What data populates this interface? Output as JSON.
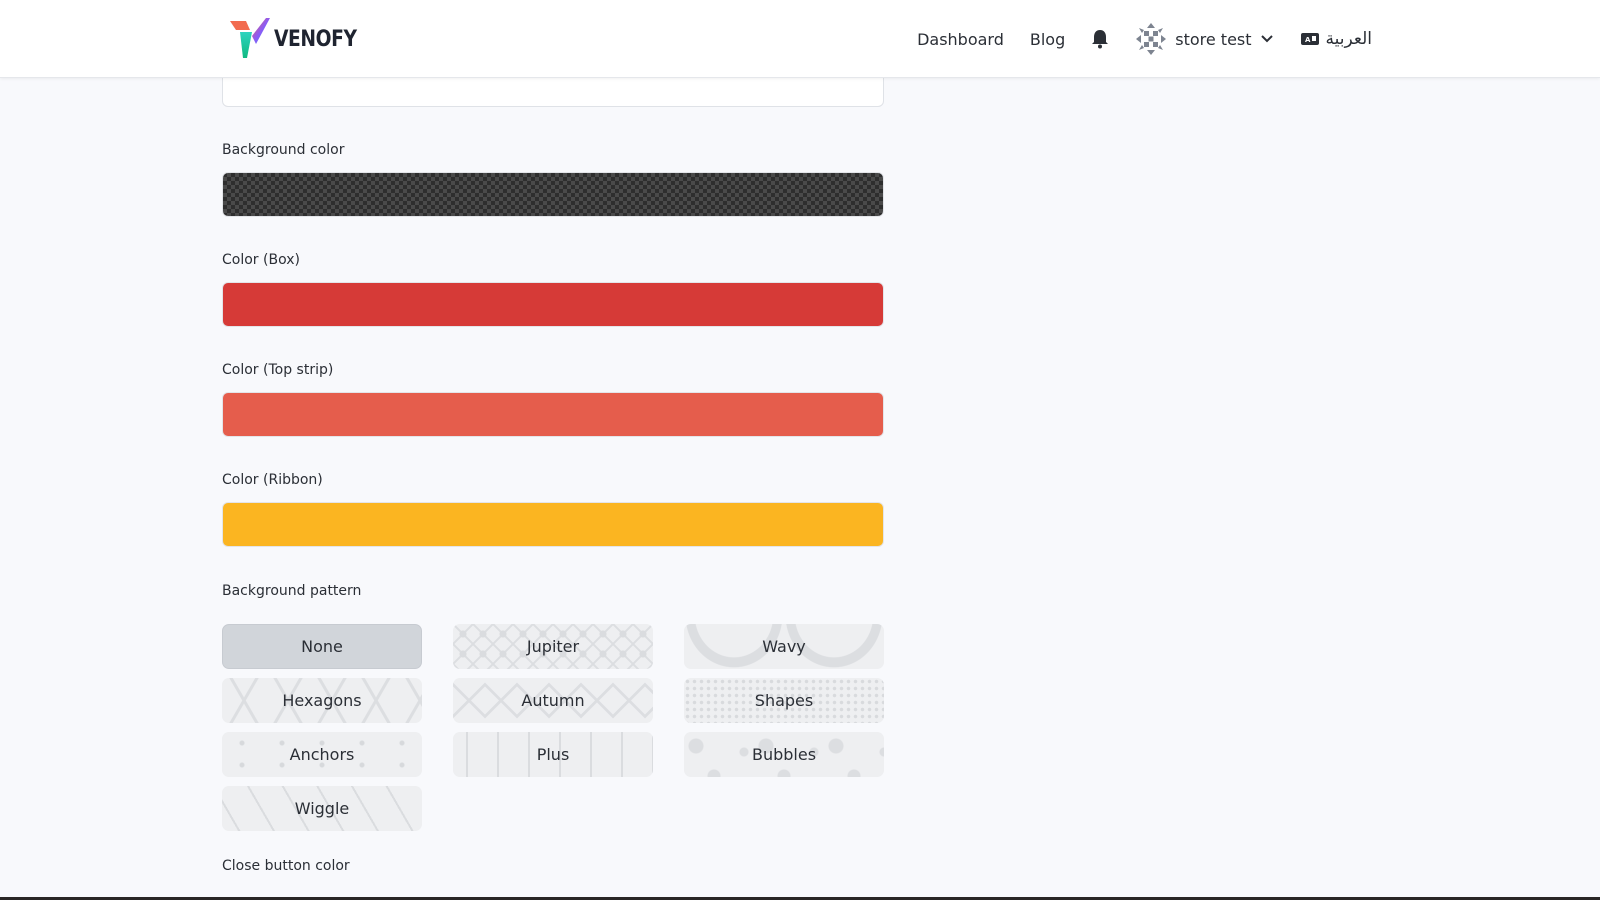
{
  "header": {
    "logo_text": "VENOFY",
    "nav": {
      "dashboard": "Dashboard",
      "blog": "Blog",
      "store_name": "store test",
      "language": "العربية"
    }
  },
  "form": {
    "background_color": {
      "label": "Background color",
      "value": "transparent"
    },
    "color_box": {
      "label": "Color (Box)",
      "value": "#d63a37"
    },
    "color_top_strip": {
      "label": "Color (Top strip)",
      "value": "#e55d4c"
    },
    "color_ribbon": {
      "label": "Color (Ribbon)",
      "value": "#fbb521"
    },
    "background_pattern": {
      "label": "Background pattern",
      "selected": "None",
      "options": [
        "None",
        "Jupiter",
        "Wavy",
        "Hexagons",
        "Autumn",
        "Shapes",
        "Anchors",
        "Plus",
        "Bubbles",
        "Wiggle"
      ]
    },
    "close_button_color": {
      "label": "Close button color"
    }
  },
  "icons": {
    "notifications": "bell-icon",
    "store_avatar": "store-avatar-icon",
    "dropdown": "chevron-down-icon",
    "language": "language-icon"
  }
}
